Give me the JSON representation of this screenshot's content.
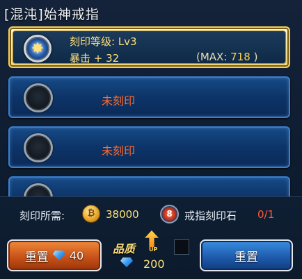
{
  "title": "[混沌]始神戒指",
  "slots": [
    {
      "level_label": "刻印等级: Lv3",
      "stat_label": "暴击 + 32",
      "max_prefix": "(MAX: ",
      "max_value": "718",
      "max_suffix": " )"
    },
    {
      "status": "未刻印"
    },
    {
      "status": "未刻印"
    }
  ],
  "requirement": {
    "label": "刻印所需:",
    "gold_amount": "38000",
    "stone_name": "戒指刻印石",
    "stone_count": "0/1"
  },
  "buttons": {
    "reset_left_label": "重置",
    "reset_left_cost": "40",
    "quality_label": "品质",
    "quality_up": "UP",
    "quality_cost": "200",
    "reset_right_label": "重置"
  },
  "colors": {
    "accent_gold": "#ffe079",
    "unset_red": "#ff6a2a",
    "slot_blue": "#164a86",
    "button_orange": "#c9531a",
    "button_blue": "#1f5cae"
  }
}
